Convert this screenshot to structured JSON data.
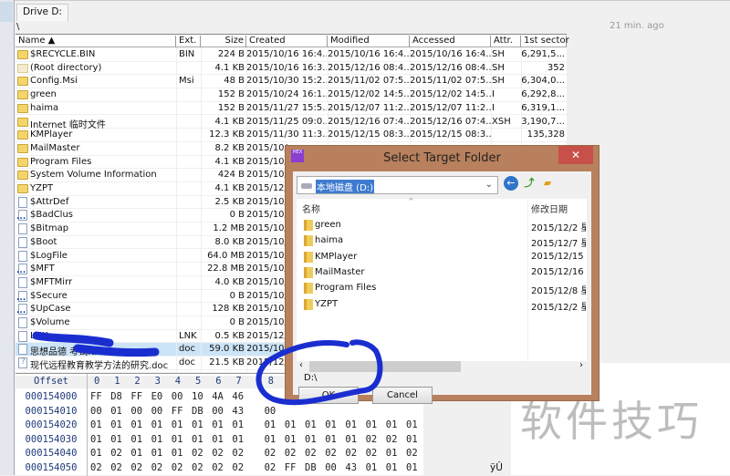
{
  "tab": {
    "label": "Drive D:"
  },
  "path": "\\",
  "status_time": "21 min. ago",
  "columns": [
    "Name ▲",
    "Ext.",
    "Size",
    "Created",
    "Modified",
    "Accessed",
    "Attr.",
    "1st sector"
  ],
  "rows": [
    {
      "icon": "folder",
      "name": "$RECYCLE.BIN",
      "ext": "BIN",
      "size": "224 B",
      "created": "2015/10/16  16:4...",
      "modified": "2015/10/16  16:4...",
      "accessed": "2015/10/16  16:4...",
      "attr": "SH",
      "sector": "6,291,5..."
    },
    {
      "icon": "root",
      "name": "(Root directory)",
      "ext": "",
      "size": "4.1 KB",
      "created": "2015/10/16  16:3...",
      "modified": "2015/12/16  08:4...",
      "accessed": "2015/12/16  08:4...",
      "attr": "SH",
      "sector": "352"
    },
    {
      "icon": "folder",
      "name": "Config.Msi",
      "ext": "Msi",
      "size": "48 B",
      "created": "2015/10/30  15:2...",
      "modified": "2015/11/02  07:5...",
      "accessed": "2015/11/02  07:5...",
      "attr": "SH",
      "sector": "6,304,0..."
    },
    {
      "icon": "folder",
      "name": "green",
      "ext": "",
      "size": "152 B",
      "created": "2015/10/24  16:1...",
      "modified": "2015/12/02  14:5...",
      "accessed": "2015/12/02  14:5...",
      "attr": "I",
      "sector": "6,292,8..."
    },
    {
      "icon": "folder",
      "name": "haima",
      "ext": "",
      "size": "152 B",
      "created": "2015/11/27  15:5...",
      "modified": "2015/12/07  11:2...",
      "accessed": "2015/12/07  11:2...",
      "attr": "I",
      "sector": "6,319,1..."
    },
    {
      "icon": "folder",
      "name": "Internet 临时文件",
      "ext": "",
      "size": "4.1 KB",
      "created": "2015/11/25  09:0...",
      "modified": "2015/12/16  07:4...",
      "accessed": "2015/12/16  07:4...",
      "attr": "XSH",
      "sector": "3,190,7..."
    },
    {
      "icon": "folder",
      "name": "KMPlayer",
      "ext": "",
      "size": "12.3 KB",
      "created": "2015/11/30  11:3...",
      "modified": "2015/12/15  08:3...",
      "accessed": "2015/12/15  08:3...",
      "attr": "",
      "sector": "135,328"
    },
    {
      "icon": "folder",
      "name": "MailMaster",
      "ext": "",
      "size": "8.2 KB",
      "created": "2015/10/",
      "modified": "",
      "accessed": "",
      "attr": "",
      "sector": ""
    },
    {
      "icon": "folder",
      "name": "Program Files",
      "ext": "",
      "size": "4.1 KB",
      "created": "2015/10/",
      "modified": "",
      "accessed": "",
      "attr": "",
      "sector": ""
    },
    {
      "icon": "folder",
      "name": "System Volume Information",
      "ext": "",
      "size": "424 B",
      "created": "2015/10/",
      "modified": "",
      "accessed": "",
      "attr": "",
      "sector": ""
    },
    {
      "icon": "folder",
      "name": "YZPT",
      "ext": "",
      "size": "4.1 KB",
      "created": "2015/12/",
      "modified": "",
      "accessed": "",
      "attr": "",
      "sector": ""
    },
    {
      "icon": "file",
      "name": "$AttrDef",
      "ext": "",
      "size": "2.5 KB",
      "created": "2015/10/",
      "modified": "",
      "accessed": "",
      "attr": "",
      "sector": ""
    },
    {
      "icon": "sys",
      "name": "$BadClus",
      "ext": "",
      "size": "0 B",
      "created": "2015/10/",
      "modified": "",
      "accessed": "",
      "attr": "",
      "sector": ""
    },
    {
      "icon": "file",
      "name": "$Bitmap",
      "ext": "",
      "size": "1.2 MB",
      "created": "2015/10/",
      "modified": "",
      "accessed": "",
      "attr": "",
      "sector": ""
    },
    {
      "icon": "file",
      "name": "$Boot",
      "ext": "",
      "size": "8.0 KB",
      "created": "2015/10/",
      "modified": "",
      "accessed": "",
      "attr": "",
      "sector": ""
    },
    {
      "icon": "file",
      "name": "$LogFile",
      "ext": "",
      "size": "64.0 MB",
      "created": "2015/10/",
      "modified": "",
      "accessed": "",
      "attr": "",
      "sector": ""
    },
    {
      "icon": "sys",
      "name": "$MFT",
      "ext": "",
      "size": "22.8 MB",
      "created": "2015/10/",
      "modified": "",
      "accessed": "",
      "attr": "",
      "sector": ""
    },
    {
      "icon": "file",
      "name": "$MFTMirr",
      "ext": "",
      "size": "4.0 KB",
      "created": "2015/10/",
      "modified": "",
      "accessed": "",
      "attr": "",
      "sector": ""
    },
    {
      "icon": "sys",
      "name": "$Secure",
      "ext": "",
      "size": "0 B",
      "created": "2015/10/",
      "modified": "",
      "accessed": "",
      "attr": "",
      "sector": ""
    },
    {
      "icon": "sys",
      "name": "$UpCase",
      "ext": "",
      "size": "128 KB",
      "created": "2015/10/",
      "modified": "",
      "accessed": "",
      "attr": "",
      "sector": ""
    },
    {
      "icon": "file",
      "name": "$Volume",
      "ext": "",
      "size": "0 B",
      "created": "2015/10/",
      "modified": "",
      "accessed": "",
      "attr": "",
      "sector": ""
    },
    {
      "icon": "file",
      "name": "LNK",
      "ext": "LNK",
      "size": "0.5 KB",
      "created": "2015/12/",
      "modified": "",
      "accessed": "",
      "attr": "",
      "sector": ""
    },
    {
      "icon": "file",
      "name": "思想品德                    考试.doc",
      "ext": "doc",
      "size": "59.0 KB",
      "created": "2015/10/",
      "modified": "",
      "accessed": "",
      "attr": "",
      "sector": "",
      "selected": true
    },
    {
      "icon": "q",
      "name": "现代远程教育教学方法的研究.doc",
      "ext": "doc",
      "size": "21.5 KB",
      "created": "2015/12/",
      "modified": "",
      "accessed": "",
      "attr": "",
      "sector": ""
    }
  ],
  "hex": {
    "header": "Offset",
    "cols": [
      "0",
      "1",
      "2",
      "3",
      "4",
      "5",
      "6",
      "7",
      "8"
    ],
    "rows": [
      {
        "offset": "000154000",
        "bytes": [
          "FF",
          "D8",
          "FF",
          "E0",
          "00",
          "10",
          "4A",
          "46"
        ]
      },
      {
        "offset": "000154010",
        "bytes": [
          "00",
          "01",
          "00",
          "00",
          "FF",
          "DB",
          "00",
          "43",
          "00"
        ]
      },
      {
        "offset": "000154020",
        "bytes": [
          "01",
          "01",
          "01",
          "01",
          "01",
          "01",
          "01",
          "01",
          "01",
          "01",
          "01",
          "01",
          "01",
          "01",
          "01",
          "01"
        ]
      },
      {
        "offset": "000154030",
        "bytes": [
          "01",
          "01",
          "01",
          "01",
          "01",
          "01",
          "01",
          "01",
          "01",
          "01",
          "01",
          "01",
          "01",
          "02",
          "02",
          "01"
        ]
      },
      {
        "offset": "000154040",
        "bytes": [
          "01",
          "02",
          "01",
          "01",
          "01",
          "02",
          "02",
          "02",
          "02",
          "02",
          "02",
          "02",
          "02",
          "02",
          "01",
          "02"
        ]
      },
      {
        "offset": "000154050",
        "bytes": [
          "02",
          "02",
          "02",
          "02",
          "02",
          "02",
          "02",
          "02",
          "02",
          "FF",
          "DB",
          "00",
          "43",
          "01",
          "01",
          "01"
        ]
      }
    ],
    "text_char": "ÿÛ"
  },
  "dialog": {
    "title": "Select Target Folder",
    "close": "✕",
    "location": "本地磁盘 (D:)",
    "col_name": "名称",
    "col_date": "修改日期",
    "folders": [
      {
        "name": "green",
        "date": "2015/12/2 星"
      },
      {
        "name": "haima",
        "date": "2015/12/7 星"
      },
      {
        "name": "KMPlayer",
        "date": "2015/12/15 !"
      },
      {
        "name": "MailMaster",
        "date": "2015/12/16 !"
      },
      {
        "name": "Program Files",
        "date": "2015/12/8 星"
      },
      {
        "name": "YZPT",
        "date": "2015/12/2 星"
      }
    ],
    "selected_path": "D:\\",
    "ok": "OK",
    "cancel": "Cancel"
  },
  "watermark": "软件技巧"
}
